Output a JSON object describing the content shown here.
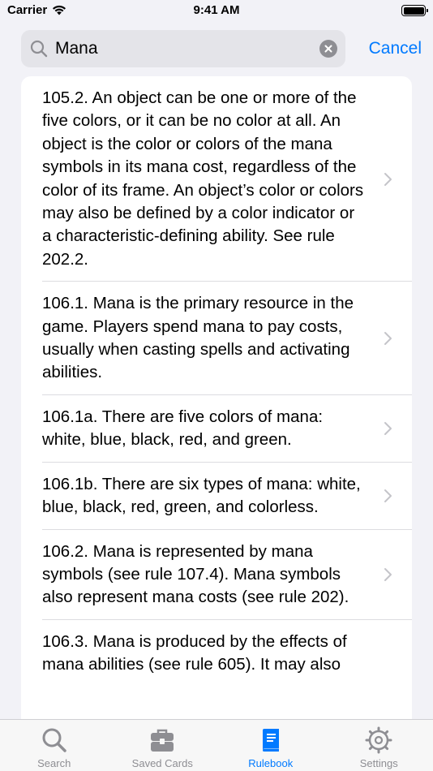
{
  "status_bar": {
    "carrier": "Carrier",
    "time": "9:41 AM"
  },
  "search": {
    "value": "Mana",
    "cancel_label": "Cancel"
  },
  "results": [
    {
      "text": "105.2. An object can be one or more of the five colors, or it can be no color at all. An object is the color or colors of the mana symbols in its mana cost, regardless of the color of its frame. An object’s color or colors may also be defined by a color indicator or a characteristic-defining ability. See rule 202.2."
    },
    {
      "text": "106.1. Mana is the primary resource in the game. Players spend mana to pay costs, usually when casting spells and activating abilities."
    },
    {
      "text": "106.1a. There are five colors of mana: white, blue, black, red, and green."
    },
    {
      "text": "106.1b. There are six types of mana: white, blue, black, red, green, and colorless."
    },
    {
      "text": "106.2. Mana is represented by mana symbols (see rule 107.4). Mana symbols also represent mana costs (see rule 202)."
    },
    {
      "text": "106.3. Mana is produced by the effects of mana abilities (see rule 605). It may also"
    }
  ],
  "tab_bar": {
    "tabs": [
      {
        "label": "Search",
        "icon": "search-icon"
      },
      {
        "label": "Saved Cards",
        "icon": "toolbox-icon"
      },
      {
        "label": "Rulebook",
        "icon": "book-icon"
      },
      {
        "label": "Settings",
        "icon": "gear-icon"
      }
    ],
    "active_index": 2
  },
  "colors": {
    "accent": "#007aff",
    "inactive_tab": "#8e8e93",
    "background": "#f2f2f7"
  }
}
